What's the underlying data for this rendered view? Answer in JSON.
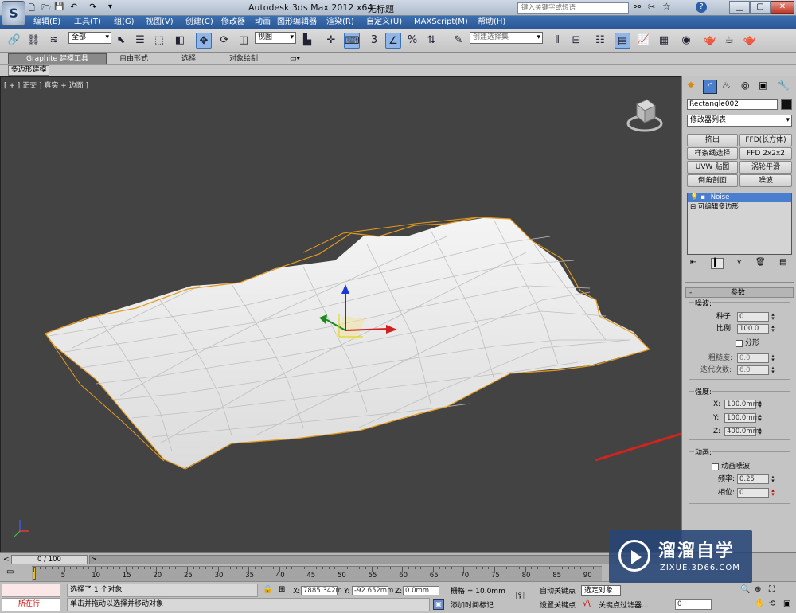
{
  "title_bar": {
    "app_title": "Autodesk 3ds Max  2012 x64",
    "doc_title": "无标题",
    "search_placeholder": "键入关键字或短语"
  },
  "menu": [
    "编辑(E)",
    "工具(T)",
    "组(G)",
    "视图(V)",
    "创建(C)",
    "修改器",
    "动画",
    "图形编辑器",
    "渲染(R)",
    "自定义(U)",
    "MAXScript(M)",
    "帮助(H)"
  ],
  "toolbar": {
    "selection_filter": "全部",
    "ref_coord": "视图",
    "named_selection": "创建选择集",
    "num_3": "3"
  },
  "ribbon": {
    "tabs": [
      "Graphite 建模工具",
      "自由形式",
      "选择",
      "对象绘制"
    ],
    "sub_tab": "多边形建模"
  },
  "viewport": {
    "label": "[ + ] 正交 ] 真实 + 边面 ]"
  },
  "cmd_panel": {
    "object_name": "Rectangle002",
    "modifier_list": "修改器列表",
    "buttons": [
      "挤出",
      "FFD(长方体)",
      "样条线选择",
      "FFD 2x2x2",
      "UVW 贴图",
      "涡轮平滑",
      "倒角剖面",
      "噪波"
    ],
    "stack": [
      "Noise",
      "可编辑多边形"
    ],
    "rollout_title": "参数",
    "noise": {
      "group": "噪波:",
      "seed_label": "种子:",
      "seed": "0",
      "scale_label": "比例:",
      "scale": "100.0",
      "fractal": "分形",
      "rough_label": "粗糙度:",
      "rough": "0.0",
      "iter_label": "迭代次数:",
      "iter": "6.0"
    },
    "strength": {
      "group": "强度:",
      "x_label": "X:",
      "x": "100.0mm",
      "y_label": "Y:",
      "y": "100.0mm",
      "z_label": "Z:",
      "z": "400.0mm"
    },
    "anim": {
      "group": "动画:",
      "anim_noise": "动画噪波",
      "freq_label": "频率:",
      "freq": "0.25",
      "phase_label": "相位:",
      "phase": "0"
    }
  },
  "timeline": {
    "frame": "0 / 100",
    "ticks": [
      "0",
      "5",
      "10",
      "15",
      "20",
      "25",
      "30",
      "35",
      "40",
      "45",
      "50",
      "55",
      "60",
      "65",
      "70",
      "75",
      "80",
      "85",
      "90"
    ]
  },
  "status": {
    "running": "所在行:",
    "msg1": "选择了 1 个对象",
    "msg2": "单击并拖动以选择并移动对象",
    "x_label": "X:",
    "x": "7885.342m",
    "y_label": "Y:",
    "y": "-92.652mm",
    "z_label": "Z:",
    "z": "0.0mm",
    "grid": "栅格 = 10.0mm",
    "add_key": "添加时间标记",
    "auto_key": "自动关键点",
    "selected": "选定对象",
    "set_key": "设置关键点",
    "key_filter": "关键点过滤器...",
    "frame_val": "0"
  },
  "watermark": {
    "brand": "溜溜自学",
    "url": "ZIXUE.3D66.COM"
  },
  "colors": {
    "accent_red": "#d3231c",
    "selection_orange": "#e39a1e"
  }
}
